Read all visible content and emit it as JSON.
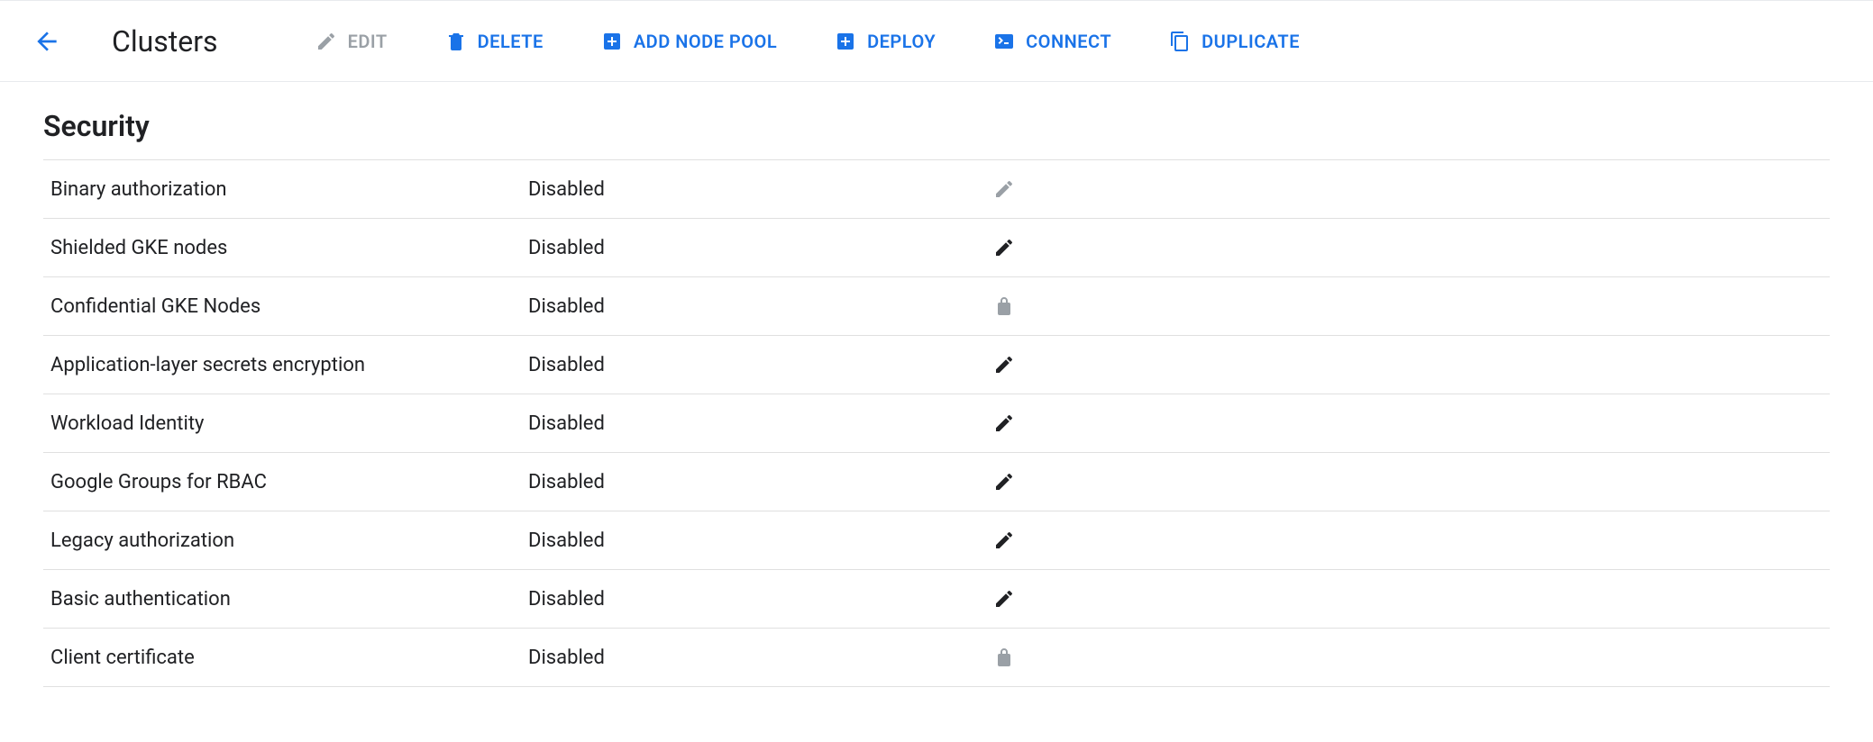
{
  "header": {
    "title": "Clusters",
    "actions": [
      {
        "id": "edit",
        "label": "EDIT",
        "icon": "pencil",
        "disabled": true
      },
      {
        "id": "delete",
        "label": "DELETE",
        "icon": "trash",
        "disabled": false
      },
      {
        "id": "addnodepool",
        "label": "ADD NODE POOL",
        "icon": "plus-box",
        "disabled": false
      },
      {
        "id": "deploy",
        "label": "DEPLOY",
        "icon": "plus-box",
        "disabled": false
      },
      {
        "id": "connect",
        "label": "CONNECT",
        "icon": "terminal",
        "disabled": false
      },
      {
        "id": "duplicate",
        "label": "DUPLICATE",
        "icon": "copy",
        "disabled": false
      }
    ]
  },
  "section": {
    "title": "Security",
    "rows": [
      {
        "key": "Binary authorization",
        "value": "Disabled",
        "action": "edit-muted"
      },
      {
        "key": "Shielded GKE nodes",
        "value": "Disabled",
        "action": "edit"
      },
      {
        "key": "Confidential GKE Nodes",
        "value": "Disabled",
        "action": "lock"
      },
      {
        "key": "Application-layer secrets encryption",
        "value": "Disabled",
        "action": "edit"
      },
      {
        "key": "Workload Identity",
        "value": "Disabled",
        "action": "edit"
      },
      {
        "key": "Google Groups for RBAC",
        "value": "Disabled",
        "action": "edit"
      },
      {
        "key": "Legacy authorization",
        "value": "Disabled",
        "action": "edit"
      },
      {
        "key": "Basic authentication",
        "value": "Disabled",
        "action": "edit"
      },
      {
        "key": "Client certificate",
        "value": "Disabled",
        "action": "lock"
      }
    ]
  },
  "colors": {
    "accent": "#1a73e8",
    "muted": "#9aa0a6"
  }
}
